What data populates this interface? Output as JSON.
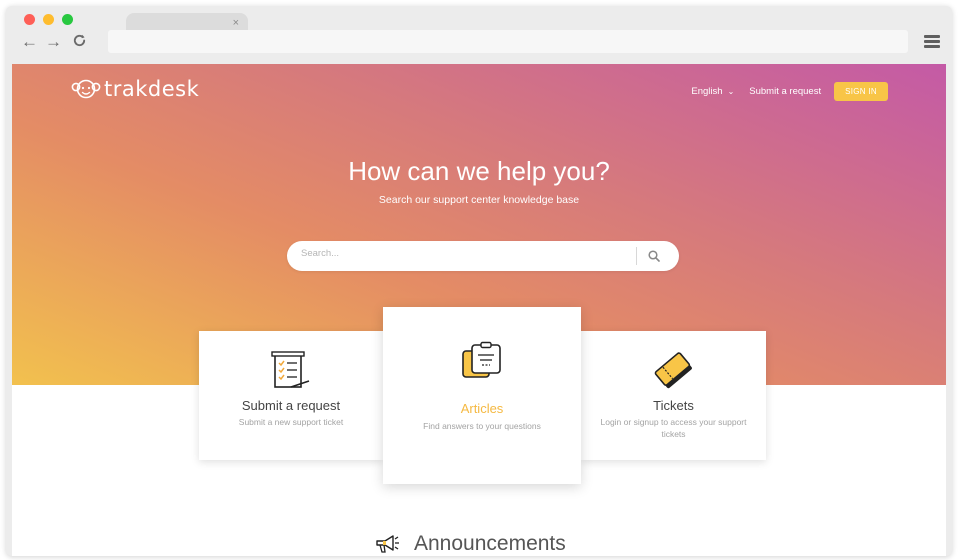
{
  "browser": {
    "tab_close": "×",
    "nav_back": "←",
    "nav_forward": "→",
    "nav_reload": "C"
  },
  "header": {
    "brand": "trakdesk",
    "language": "English",
    "submit_link": "Submit a request",
    "sign_in": "SIGN IN"
  },
  "hero": {
    "title": "How can we help you?",
    "subtitle": "Search our support center knowledge base",
    "search_placeholder": "Search..."
  },
  "cards": [
    {
      "title": "Submit a request",
      "description": "Submit a new support ticket",
      "icon": "form-icon"
    },
    {
      "title": "Articles",
      "description": "Find answers to your questions",
      "icon": "articles-icon"
    },
    {
      "title": "Tickets",
      "description": "Login or signup to access your support tickets",
      "icon": "ticket-icon"
    }
  ],
  "announcements": {
    "title": "Announcements",
    "icon": "megaphone-icon"
  },
  "colors": {
    "accent": "#f8c547",
    "gradient_start": "#f2c14e",
    "gradient_mid": "#d67a7c",
    "gradient_end": "#c45aa6",
    "highlight_title": "#f5b942"
  }
}
